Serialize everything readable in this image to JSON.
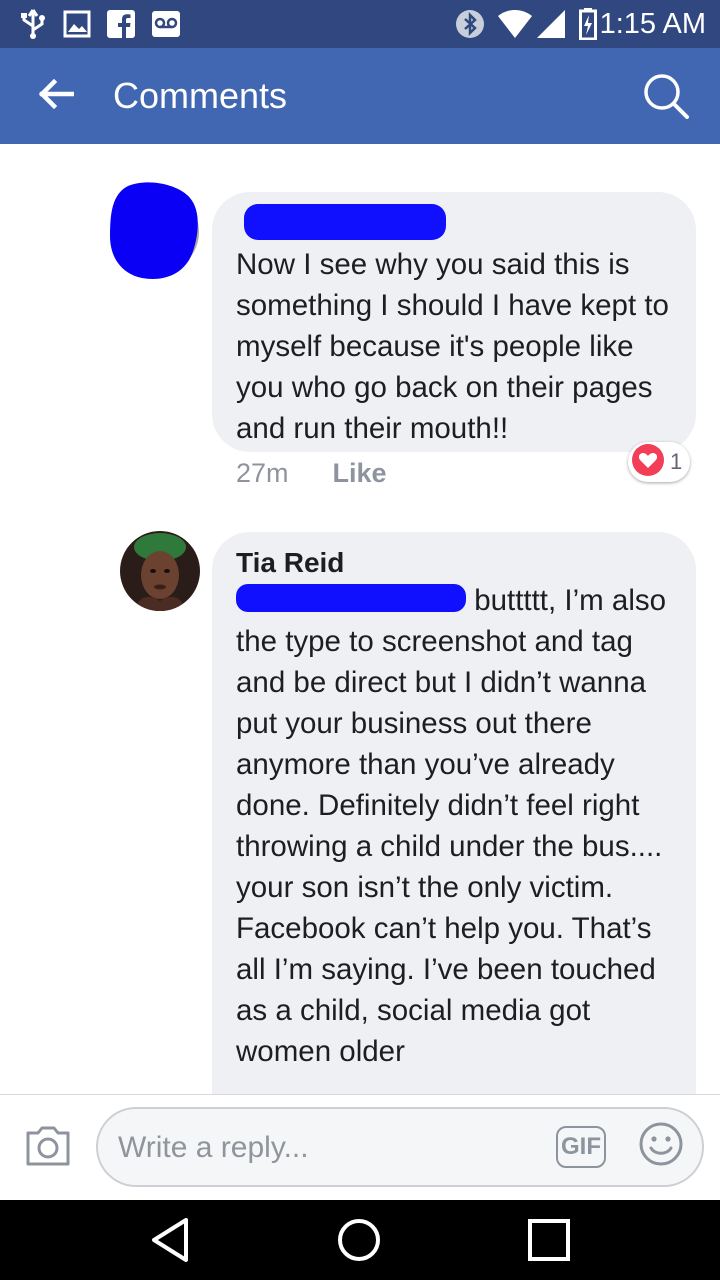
{
  "status_bar": {
    "time": "1:15 AM",
    "icons": [
      "usb-icon",
      "image-icon",
      "facebook-icon",
      "voicemail-icon",
      "bluetooth-icon",
      "wifi-icon",
      "signal-icon",
      "battery-icon"
    ]
  },
  "app_bar": {
    "title": "Comments",
    "back_icon": "arrow-left-icon",
    "search_icon": "search-icon"
  },
  "comments": [
    {
      "author": "",
      "text": "Now I see why you said this is something I should I have kept to myself because it's people like you who go back on their pages and run their mouth!!",
      "time": "27m",
      "like_label": "Like",
      "reaction_count": "1",
      "reaction_icon": "heart-icon"
    },
    {
      "author": "Tia Reid",
      "text_after_redaction": "buttttt, I’m also the type to screenshot and tag and be direct but I didn’t wanna put your business out there anymore than you’ve already done. Definitely didn’t feel right throwing a child under the bus.... your son isn’t the only victim. Facebook can’t help you. That’s all I’m saying. I’ve been touched as a child, social media got women older"
    }
  ],
  "reply_bar": {
    "placeholder": "Write a reply...",
    "gif_label": "GIF",
    "camera_icon": "camera-icon",
    "emoji_icon": "emoji-icon"
  },
  "nav_bar": {
    "icons": [
      "back-triangle-icon",
      "home-circle-icon",
      "recents-square-icon"
    ]
  },
  "colors": {
    "status_bar": "#30487f",
    "app_bar": "#4267b2",
    "bubble": "#eff0f3",
    "redaction": "#1010ff",
    "reaction_heart": "#f33e58"
  }
}
